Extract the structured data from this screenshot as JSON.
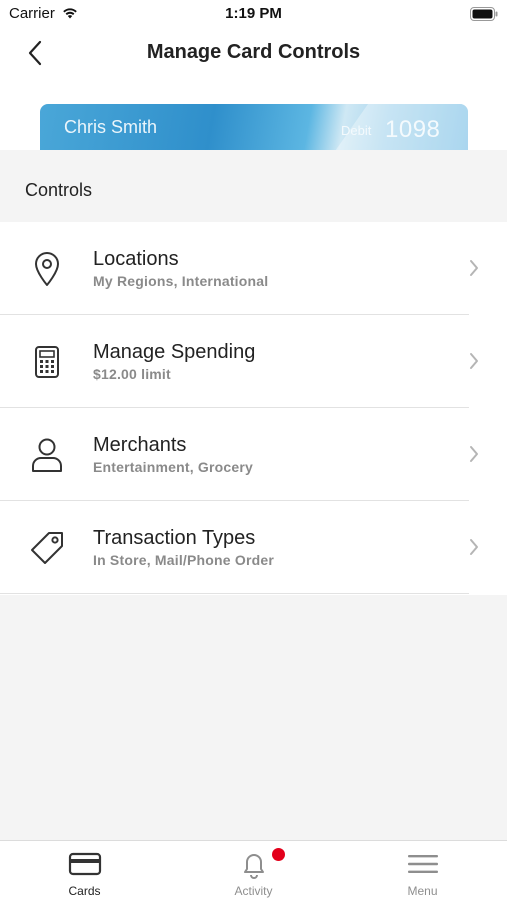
{
  "status_bar": {
    "carrier": "Carrier",
    "time": "1:19 PM"
  },
  "nav": {
    "title": "Manage Card Controls",
    "back_icon": "chevron-left-icon"
  },
  "card": {
    "holder": "Chris Smith",
    "type": "Debit",
    "last4": "1098"
  },
  "section": {
    "title": "Controls"
  },
  "controls": [
    {
      "title": "Locations",
      "subtitle": "My Regions, International",
      "icon": "map-pin-icon"
    },
    {
      "title": "Manage Spending",
      "subtitle": "$12.00 limit",
      "icon": "calculator-icon"
    },
    {
      "title": "Merchants",
      "subtitle": "Entertainment, Grocery",
      "icon": "person-icon"
    },
    {
      "title": "Transaction Types",
      "subtitle": "In Store, Mail/Phone Order",
      "icon": "tag-icon"
    }
  ],
  "tabs": [
    {
      "label": "Cards",
      "icon": "credit-card-icon",
      "active": true
    },
    {
      "label": "Activity",
      "icon": "bell-icon",
      "active": false,
      "badge": true
    },
    {
      "label": "Menu",
      "icon": "hamburger-menu-icon",
      "active": false
    }
  ],
  "colors": {
    "accent": "#2f8fcb",
    "badge": "#e3001b",
    "background": "#f4f4f4"
  }
}
